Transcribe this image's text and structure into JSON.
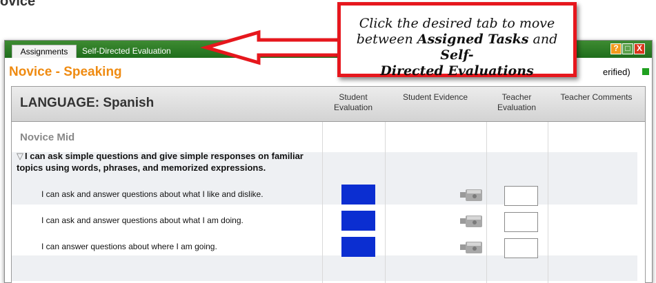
{
  "window": {
    "tabs": [
      {
        "label": "Assignments",
        "active": true
      },
      {
        "label": "Self-Directed Evaluation",
        "active": false
      }
    ],
    "controls": {
      "help": "?",
      "restore": "□",
      "close": "X"
    },
    "page_title": "Novice - Speaking",
    "verified_text": "erified)"
  },
  "table": {
    "language_label": "LANGUAGE: Spanish",
    "columns": [
      "Student Evaluation",
      "Student Evidence",
      "Teacher Evaluation",
      "Teacher Comments"
    ],
    "level": "Novice Mid",
    "can_do": "I can ask simple questions and give simple responses on familiar topics using words, phrases, and memorized expressions.",
    "statements": [
      "I can ask and answer questions about what I like and dislike.",
      "I can ask and answer questions about what I am doing.",
      "I can answer questions about where I am going."
    ]
  },
  "callout": {
    "line1": "Click the desired tab to move",
    "line2a": "between ",
    "line2b": "Assigned Tasks",
    "line2c": " and ",
    "line2d": "Self-",
    "line3": "Directed Evaluations"
  },
  "colors": {
    "titlebar_green": "#2a7a24",
    "title_orange": "#ef8b12",
    "student_eval_blue": "#0b2ed1",
    "callout_red": "#e6171d"
  },
  "icons": [
    "help-icon",
    "restore-icon",
    "close-icon",
    "camera-icon",
    "expand-triangle-icon",
    "arrow-left-icon"
  ]
}
